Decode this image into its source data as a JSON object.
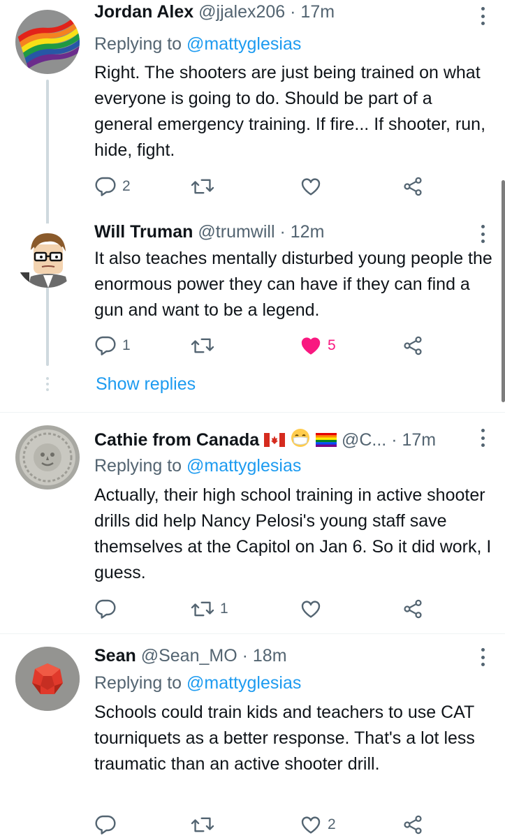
{
  "tweets": [
    {
      "name": "Jordan Alex",
      "handle": "@jjalex206",
      "time": "· 17m",
      "replying_label": "Replying to",
      "replying_to": "@mattyglesias",
      "text": "Right. The shooters are just being trained on what everyone is going to do. Should be part of a general emergency training. If fire... If shooter, run, hide, fight.",
      "reply_count": "2",
      "retweet_count": "",
      "like_count": "",
      "avatar": "rainbow-flag-avatar"
    },
    {
      "name": "Will Truman",
      "handle": "@trumwill",
      "time": "· 12m",
      "text": "It also teaches mentally disturbed young people the enormous power they can have if they can find a gun and want to be a legend.",
      "reply_count": "1",
      "retweet_count": "",
      "like_count": "5",
      "liked": true,
      "avatar": "cartoon-man-glasses-avatar",
      "show_replies": "Show replies"
    },
    {
      "name": "Cathie from Canada",
      "handle": "@C...",
      "time": "· 17m",
      "replying_label": "Replying to",
      "replying_to": "@mattyglesias",
      "text": "Actually, their high school training in active shooter drills did help Nancy Pelosi's young staff save themselves at the Capitol on Jan 6. So it did work, I guess.",
      "reply_count": "",
      "retweet_count": "1",
      "like_count": "",
      "avatar": "stone-medallion-avatar",
      "name_emojis": [
        "canada-flag",
        "mask-face",
        "rainbow-flag"
      ]
    },
    {
      "name": "Sean",
      "handle": "@Sean_MO",
      "time": "· 18m",
      "replying_label": "Replying to",
      "replying_to": "@mattyglesias",
      "text": "Schools could train kids and teachers to use CAT tourniquets as a better response. That's a lot less traumatic than an active shooter drill.",
      "reply_count": "",
      "retweet_count": "",
      "like_count": "2",
      "avatar": "red-dice-avatar"
    }
  ],
  "colors": {
    "link": "#1d9bf0",
    "secondary_text": "#536471",
    "like_active": "#f91880",
    "thread_line": "#cfd9de"
  },
  "icons": [
    "reply-icon",
    "retweet-icon",
    "like-icon",
    "share-icon",
    "more-icon"
  ]
}
